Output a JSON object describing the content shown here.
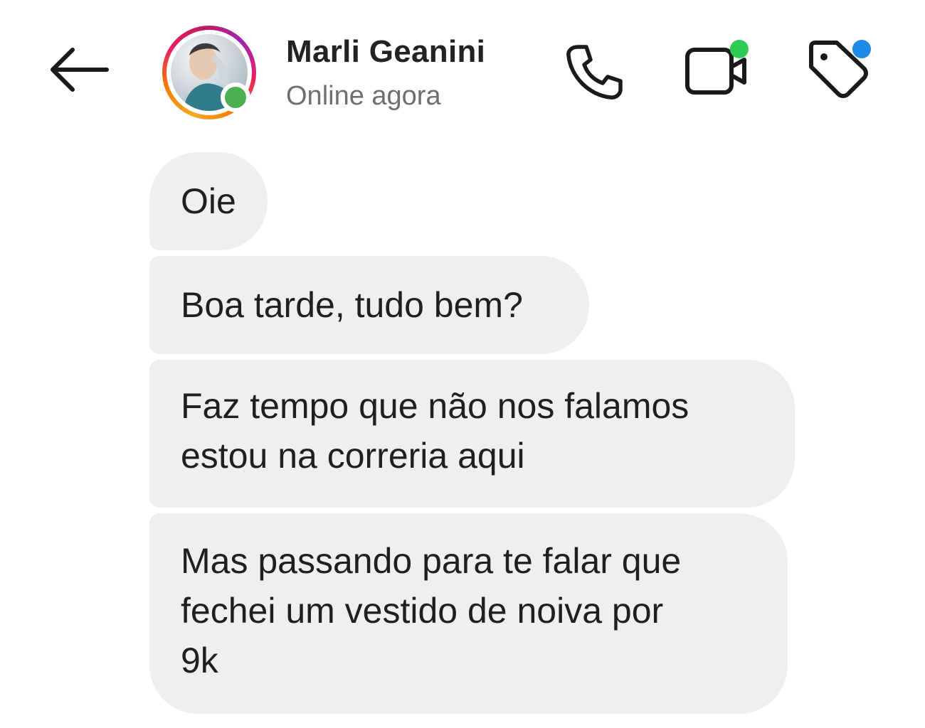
{
  "header": {
    "back_icon": "arrow-left-icon",
    "contact": {
      "name": "Marli Geanini",
      "status": "Online agora",
      "story_ring": true,
      "online": true
    },
    "actions": [
      {
        "icon": "phone-icon",
        "badge": null
      },
      {
        "icon": "video-camera-icon",
        "badge": "#2ecc55"
      },
      {
        "icon": "tag-icon",
        "badge": "#1e88e5"
      }
    ]
  },
  "messages": [
    {
      "lines": [
        "Oie"
      ]
    },
    {
      "lines": [
        "Boa tarde, tudo bem?"
      ]
    },
    {
      "lines": [
        "Faz tempo que não nos falamos",
        "estou na correria aqui"
      ]
    },
    {
      "lines": [
        "Mas passando para te falar que",
        "fechei um vestido de noiva por",
        "9k"
      ]
    }
  ],
  "colors": {
    "bubble_bg": "#efefef",
    "online_green": "#4caf50",
    "video_badge": "#2ecc55",
    "tag_badge": "#1e88e5",
    "name_text": "#222222",
    "status_text": "#6f6f6f"
  }
}
